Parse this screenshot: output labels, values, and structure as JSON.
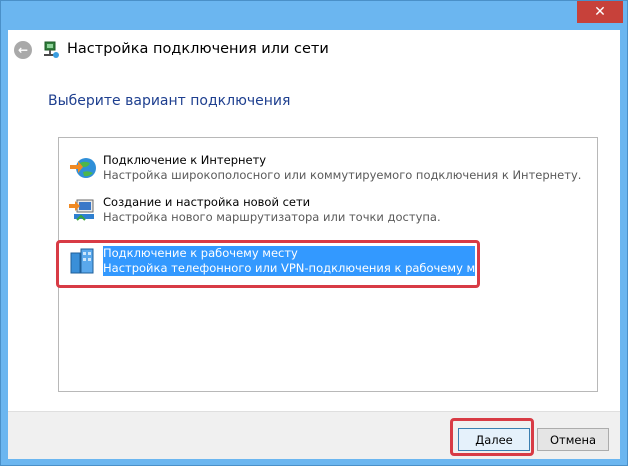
{
  "window": {
    "title": "Настройка подключения или сети",
    "close_glyph": "✕"
  },
  "header": {
    "back_glyph": "←"
  },
  "instruction": "Выберите вариант подключения",
  "options": [
    {
      "title": "Подключение к Интернету",
      "description": "Настройка широкополосного или коммутируемого подключения к Интернету.",
      "icon": "globe-network-icon"
    },
    {
      "title": "Создание и настройка новой сети",
      "description": "Настройка нового маршрутизатора или точки доступа.",
      "icon": "router-setup-icon"
    },
    {
      "title": "Подключение к рабочему месту",
      "description": "Настройка телефонного или VPN-подключения к рабочему месту.",
      "icon": "workplace-vpn-icon",
      "selected": true
    }
  ],
  "footer": {
    "next_label": "Далее",
    "cancel_label": "Отмена"
  },
  "colors": {
    "titlebar": "#6bb6f0",
    "close": "#c7413a",
    "instruction": "#1e3f8f",
    "selection": "#3399ff",
    "highlight": "#d83b45"
  }
}
